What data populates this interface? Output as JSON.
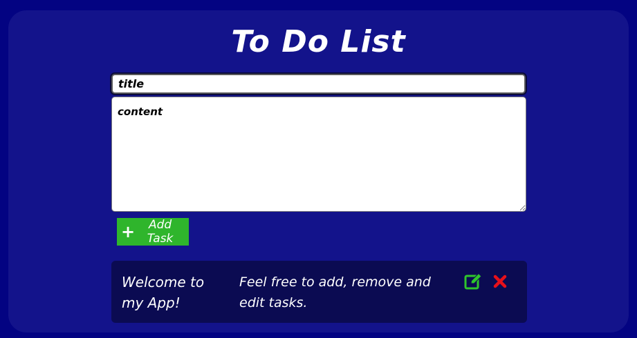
{
  "app": {
    "title": "To Do List"
  },
  "form": {
    "title_placeholder": "title",
    "title_value": "",
    "content_placeholder": "content",
    "content_value": "",
    "add_button_label": "Add Task",
    "add_button_icon": "plus-icon"
  },
  "tasks": [
    {
      "title": "Welcome to my App!",
      "content": "Feel free to add, remove and edit tasks.",
      "edit_icon": "edit-icon",
      "delete_icon": "close-icon"
    }
  ],
  "colors": {
    "background": "#030382",
    "card": "#13138b",
    "task_card": "#0b0b52",
    "accent_green": "#2fb52c",
    "edit_icon": "#2fc52c",
    "delete_icon": "#e8101a"
  }
}
